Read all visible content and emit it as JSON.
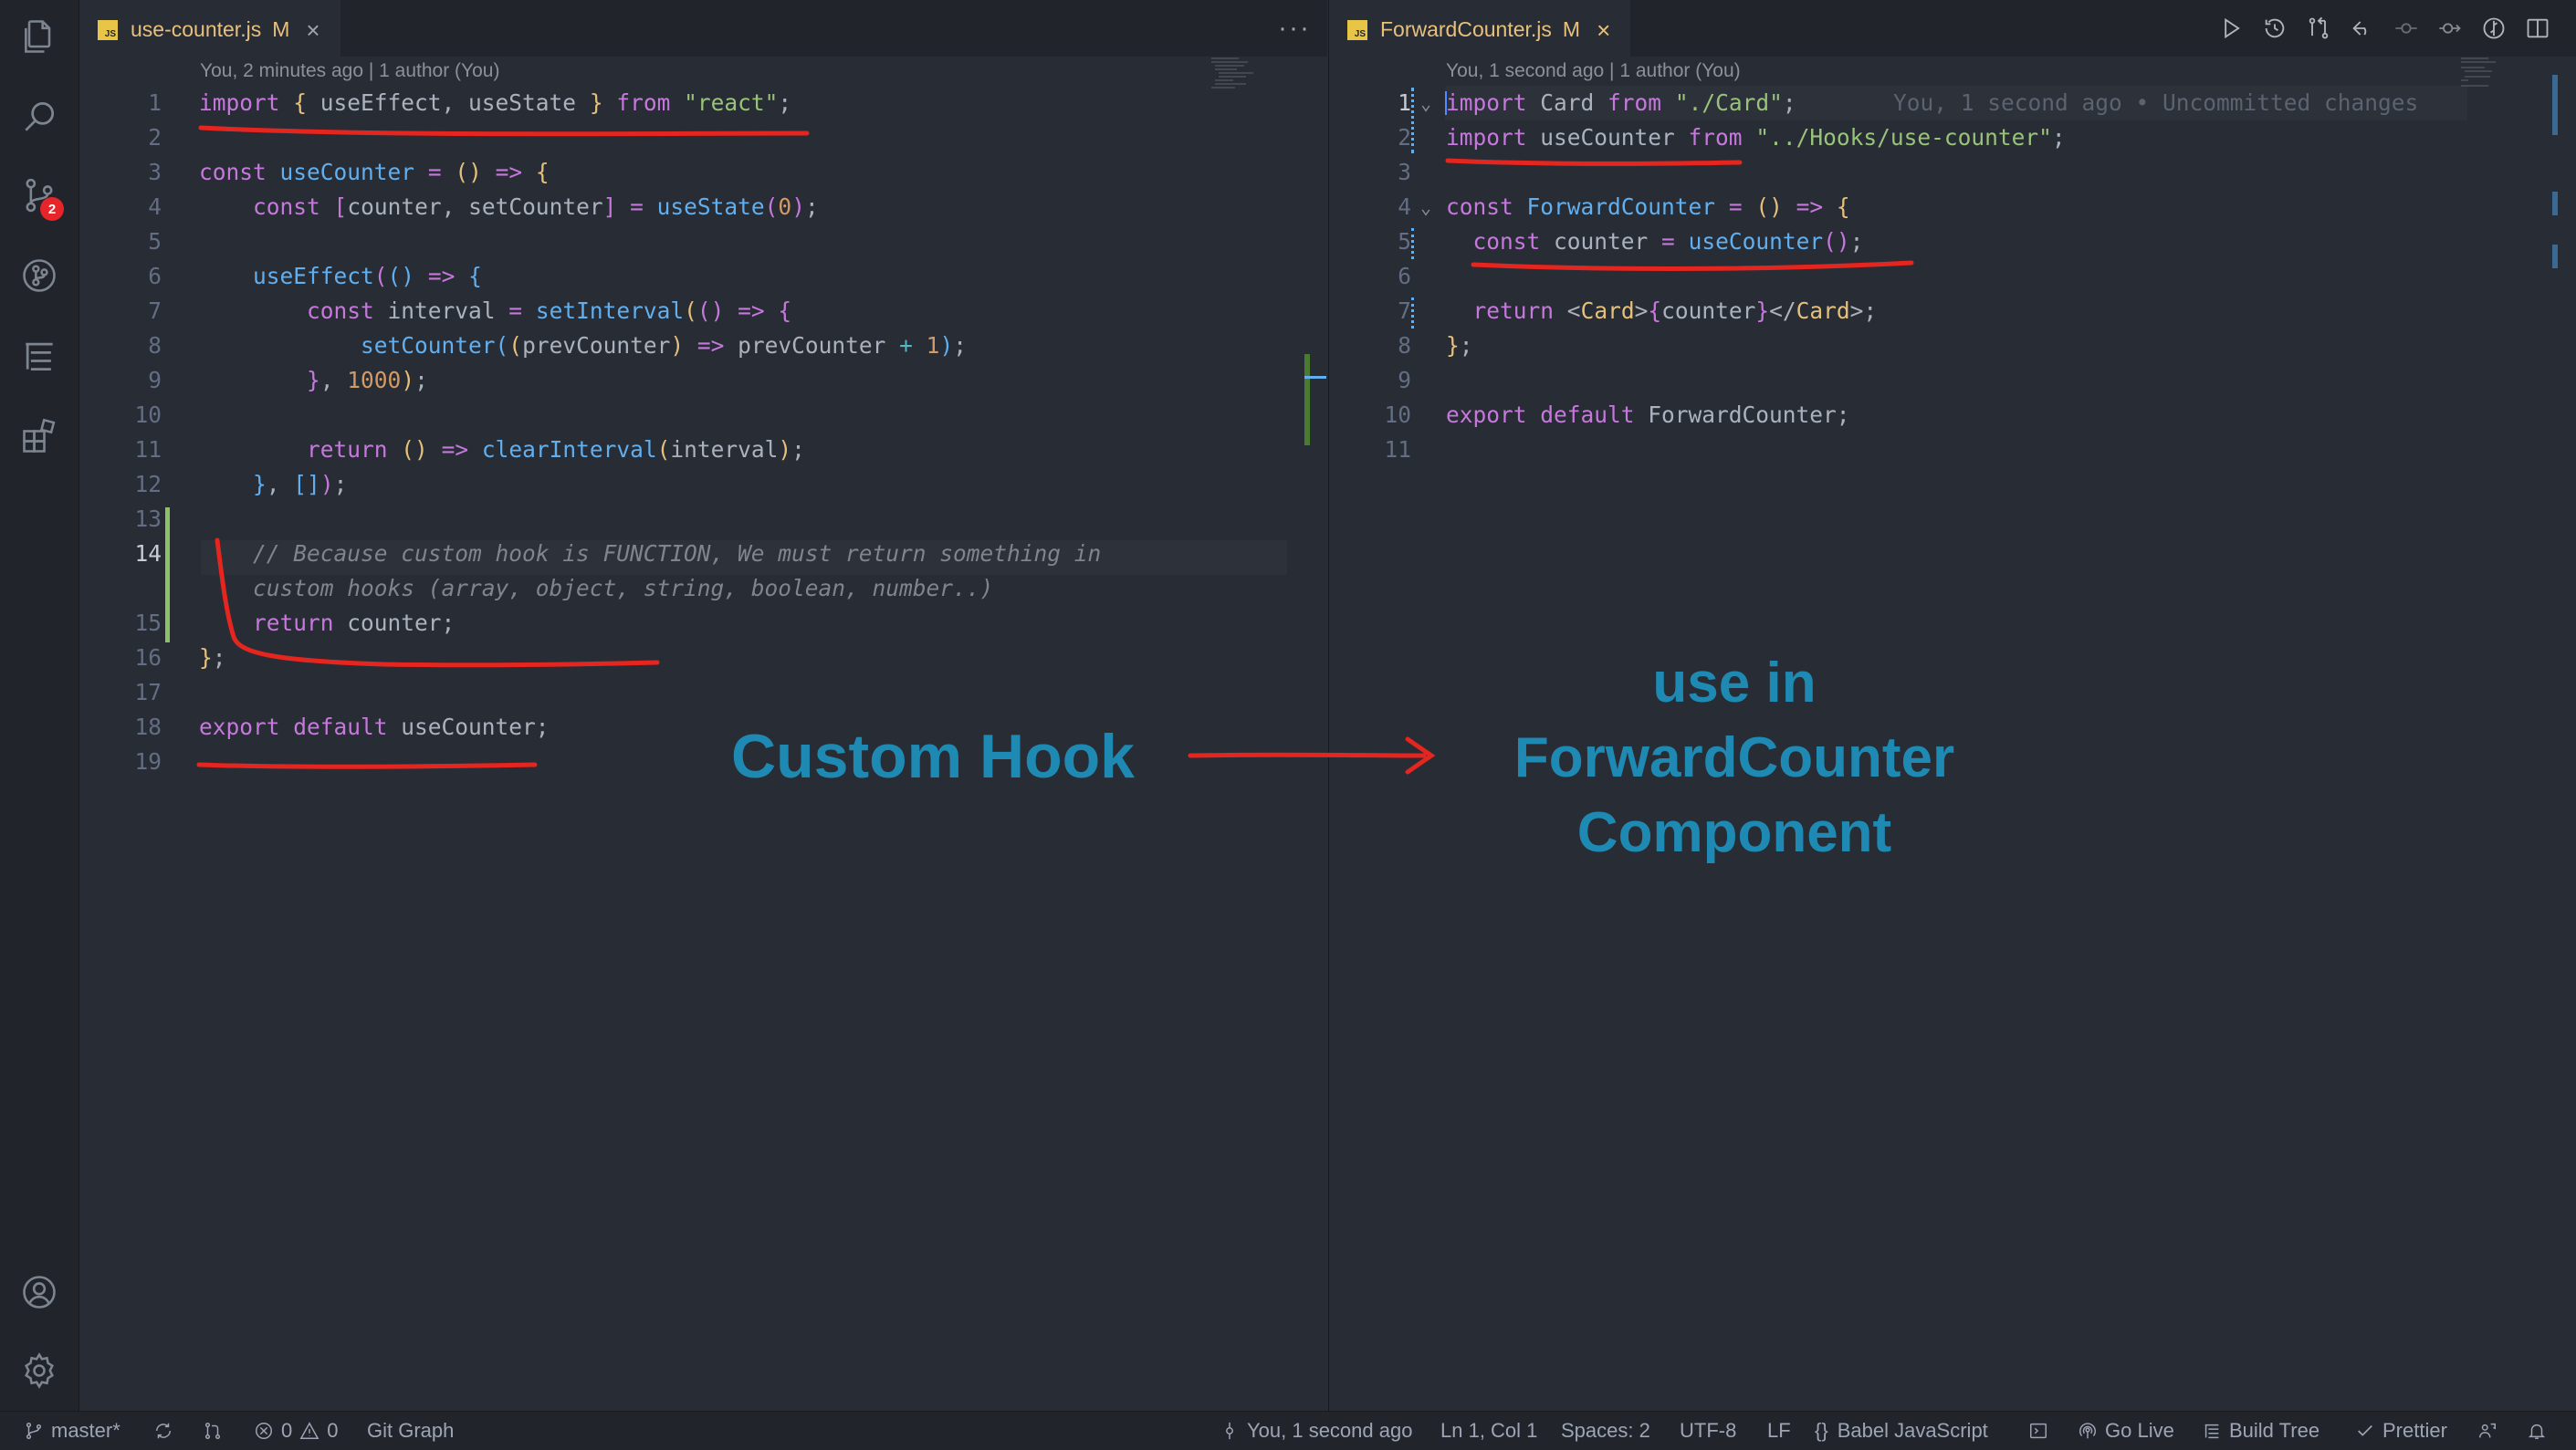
{
  "activity_bar": {
    "items": [
      {
        "icon": "files-icon"
      },
      {
        "icon": "search-icon"
      },
      {
        "icon": "source-control-icon",
        "badge": "2"
      },
      {
        "icon": "git-graph-icon"
      },
      {
        "icon": "outline-tree-icon"
      },
      {
        "icon": "extensions-icon"
      }
    ],
    "bottom": [
      {
        "icon": "account-icon"
      },
      {
        "icon": "settings-gear-icon"
      }
    ]
  },
  "left_editor": {
    "tab": {
      "file": "use-counter.js",
      "status": "M",
      "close": "×"
    },
    "more": "···",
    "blame_header": "You, 2 minutes ago | 1 author (You)",
    "line_numbers": [
      "1",
      "2",
      "3",
      "4",
      "5",
      "6",
      "7",
      "8",
      "9",
      "10",
      "11",
      "12",
      "13",
      "14",
      "",
      "15",
      "16",
      "17",
      "18",
      "19"
    ]
  },
  "right_editor": {
    "tab": {
      "file": "ForwardCounter.js",
      "status": "M",
      "close": "×"
    },
    "blame_header": "You, 1 second ago | 1 author (You)",
    "inline_blame": "You, 1 second ago • Uncommitted changes",
    "line_numbers": [
      "1",
      "2",
      "3",
      "4",
      "5",
      "6",
      "7",
      "8",
      "9",
      "10",
      "11"
    ],
    "toolbar": [
      "run-icon",
      "history-icon",
      "compare-icon",
      "revert-icon",
      "previous-change-icon",
      "next-change-icon",
      "timeline-icon",
      "split-editor-icon"
    ]
  },
  "annotations": {
    "left_label": "Custom Hook",
    "right_label_line1": "use in",
    "right_label_line2": "ForwardCounter",
    "right_label_line3": "Component"
  },
  "statusbar": {
    "branch": "master*",
    "errors": "0",
    "warnings": "0",
    "git_graph": "Git Graph",
    "blame": "You, 1 second ago",
    "cursor": "Ln 1, Col 1",
    "spaces": "Spaces: 2",
    "encoding": "UTF-8",
    "eol": "LF",
    "language_braces": "{}",
    "language": "Babel JavaScript",
    "go_live": "Go Live",
    "build_tree": "Build Tree",
    "prettier": "Prettier"
  },
  "colors": {
    "accent_annotation": "#1e8ab3",
    "red_marker": "#e5251f",
    "editor_bg": "#282c34",
    "badge": "#e5252a"
  }
}
